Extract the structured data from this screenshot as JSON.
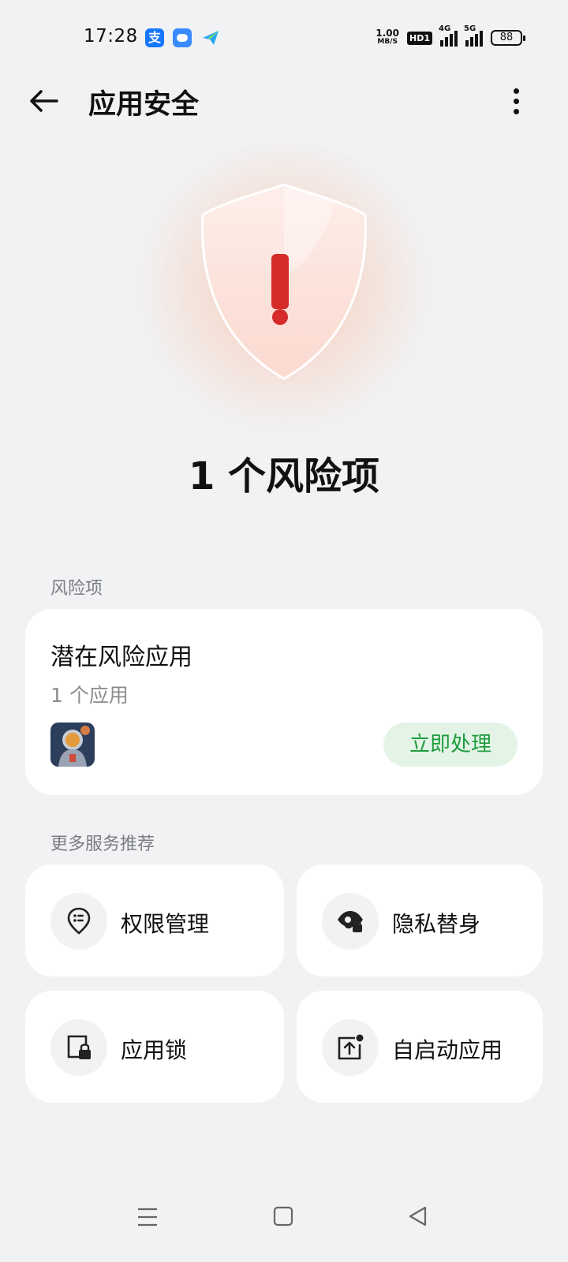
{
  "status_bar": {
    "time": "17:28",
    "speed": "1.00",
    "speed_unit": "MB/S",
    "hd": "HD1",
    "network_1": "4G",
    "network_2": "5G",
    "battery": "88",
    "notification_icons": [
      "alipay-icon",
      "weather-icon",
      "send-icon"
    ]
  },
  "header": {
    "title": "应用安全"
  },
  "hero": {
    "risk_count_text": "1 个风险项",
    "alert_color": "#d62b2b"
  },
  "risk_section": {
    "label": "风险项",
    "card": {
      "title": "潜在风险应用",
      "subtitle": "1 个应用",
      "action": "立即处理"
    }
  },
  "services_section": {
    "label": "更多服务推荐",
    "items": [
      {
        "label": "权限管理",
        "icon": "permission-icon"
      },
      {
        "label": "隐私替身",
        "icon": "privacy-icon"
      },
      {
        "label": "应用锁",
        "icon": "app-lock-icon"
      },
      {
        "label": "自启动应用",
        "icon": "auto-start-icon"
      }
    ]
  },
  "colors": {
    "background": "#f1f2f4",
    "accent_green": "#1f9d3f",
    "button_green_bg": "#e3f4e6"
  }
}
